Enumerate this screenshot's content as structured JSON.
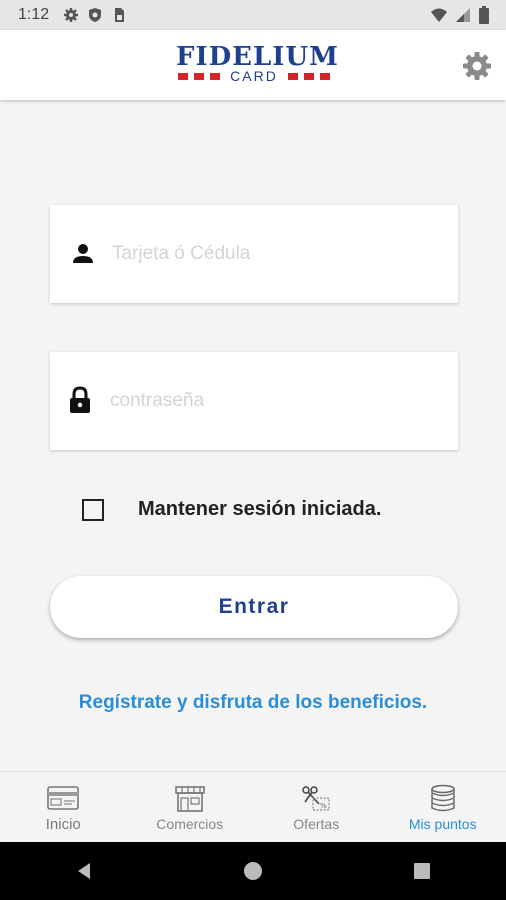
{
  "status_bar": {
    "time": "1:12",
    "left_icons": [
      "gear-icon",
      "shield-icon",
      "sim-icon"
    ],
    "right_icons": [
      "wifi-icon",
      "signal-icon",
      "battery-icon"
    ]
  },
  "app_bar": {
    "logo_text": "FIDELIUM",
    "logo_subtext": "CARD",
    "settings_icon": "gear-icon"
  },
  "login_form": {
    "card_field": {
      "placeholder": "Tarjeta ó Cédula",
      "value": "",
      "icon": "person-icon"
    },
    "password_field": {
      "placeholder": "contraseña",
      "value": "",
      "icon": "lock-icon"
    },
    "remember_label": "Mantener sesión iniciada.",
    "remember_checked": false,
    "submit_label": "Entrar",
    "register_link": "Regístrate y disfruta de los beneficios."
  },
  "bottom_nav": {
    "items": [
      {
        "label": "Inicio",
        "icon": "card-icon",
        "active": false
      },
      {
        "label": "Comercios",
        "icon": "store-icon",
        "active": false
      },
      {
        "label": "Ofertas",
        "icon": "scissors-coupon-icon",
        "active": false
      },
      {
        "label": "Mis puntos",
        "icon": "coins-icon",
        "active": true
      }
    ]
  },
  "colors": {
    "brand_blue": "#1f3f8f",
    "brand_red": "#d6232a",
    "link_blue": "#2a8fd8",
    "background": "#f4f4f4"
  }
}
